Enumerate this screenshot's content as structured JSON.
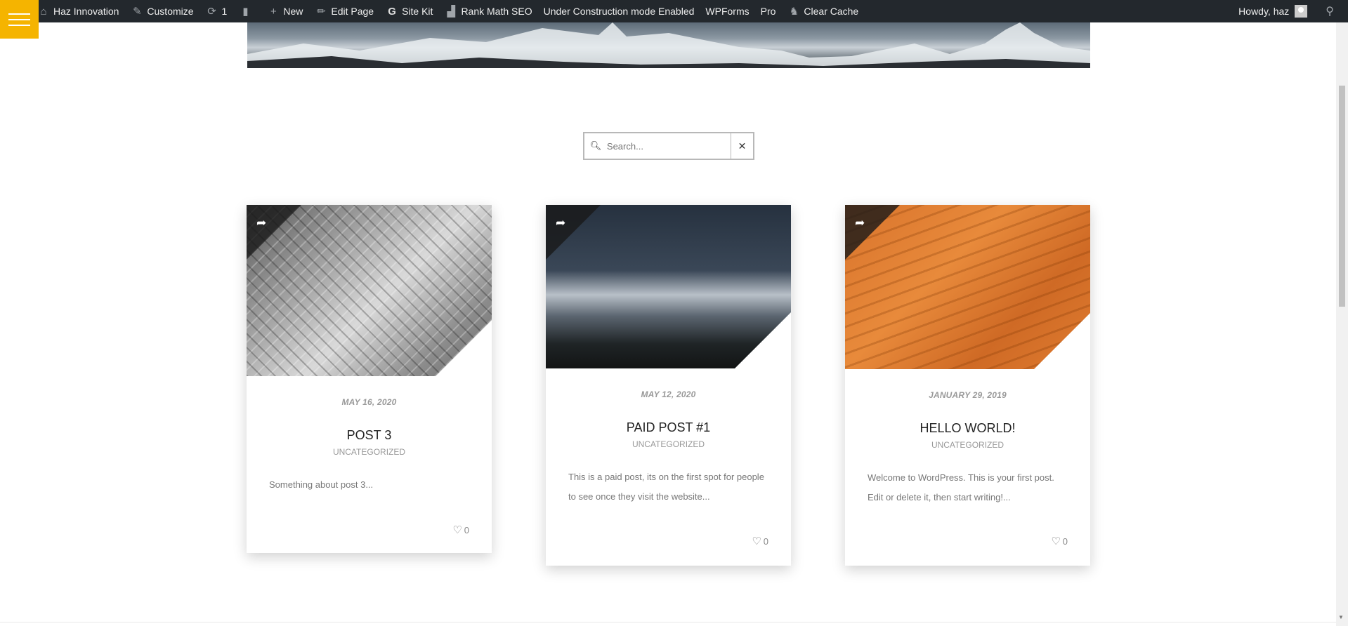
{
  "adminbar": {
    "site_name": "Haz Innovation",
    "customize": "Customize",
    "updates_count": "1",
    "new": "New",
    "edit_page": "Edit Page",
    "site_kit": "Site Kit",
    "rank_math": "Rank Math SEO",
    "under_construction": "Under Construction mode Enabled",
    "wpforms": "WPForms",
    "pro": "Pro",
    "clear_cache": "Clear Cache",
    "howdy": "Howdy, haz"
  },
  "search": {
    "placeholder": "Search..."
  },
  "posts": [
    {
      "date": "MAY 16, 2020",
      "title": "POST 3",
      "category": "UNCATEGORIZED",
      "excerpt": "Something about post 3...",
      "likes": "0"
    },
    {
      "date": "MAY 12, 2020",
      "title": "PAID POST #1",
      "category": "UNCATEGORIZED",
      "excerpt": "This is a paid post, its on the first spot for people to see once they visit the website...",
      "likes": "0"
    },
    {
      "date": "JANUARY 29, 2019",
      "title": "HELLO WORLD!",
      "category": "UNCATEGORIZED",
      "excerpt": "Welcome to WordPress. This is your first post. Edit or delete it, then start writing!...",
      "likes": "0"
    }
  ],
  "colors": {
    "adminbar_bg": "#23282d",
    "menu_toggle": "#f5b400"
  }
}
